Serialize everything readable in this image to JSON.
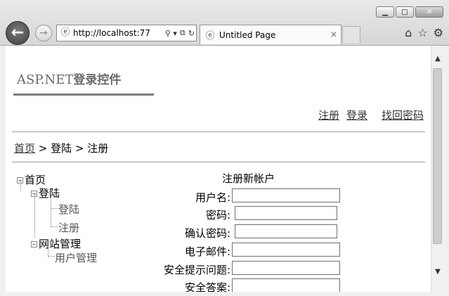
{
  "window": {
    "minimize_glyph": "▁",
    "maximize_glyph": "□",
    "close_glyph": "✕"
  },
  "nav": {
    "back_glyph": "←",
    "forward_glyph": "→"
  },
  "address_bar": {
    "url": "http://localhost:77",
    "search_glyph": "⚲ ▾",
    "compat_glyph": "⧉",
    "refresh_glyph": "↻"
  },
  "tab": {
    "title": "Untitled Page",
    "close_glyph": "×"
  },
  "toolbar_icons": {
    "home": "⌂",
    "favorites": "☆",
    "tools": "⚙"
  },
  "page": {
    "header_title_latin": "ASP.NET",
    "header_title_cn": "登录控件",
    "top_links": [
      "注册",
      "登录",
      "找回密码"
    ],
    "breadcrumb": {
      "home": "首页",
      "sep": " > ",
      "level2": "登陆",
      "current": "注册"
    },
    "tree": {
      "root": "首页",
      "login_group": "登陆",
      "login_children": [
        "登陆",
        "注册"
      ],
      "site_group": "网站管理",
      "site_children": [
        "用户管理"
      ],
      "collapse_glyph": "−"
    },
    "register_form": {
      "title": "注册新帐户",
      "fields": [
        {
          "label": "用户名:",
          "value": ""
        },
        {
          "label": "密码:",
          "value": ""
        },
        {
          "label": "确认密码:",
          "value": ""
        },
        {
          "label": "电子邮件:",
          "value": ""
        },
        {
          "label": "安全提示问题:",
          "value": ""
        },
        {
          "label": "安全答案:",
          "value": ""
        }
      ]
    }
  },
  "scrollbar": {
    "up_glyph": "▲",
    "down_glyph": "▼"
  }
}
